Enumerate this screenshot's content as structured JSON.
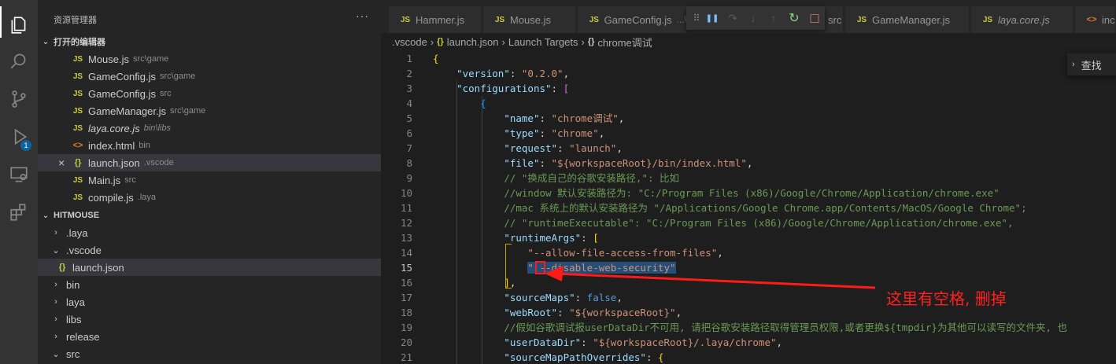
{
  "activity_bar": {
    "items": [
      {
        "icon": "files-icon"
      },
      {
        "icon": "search-icon"
      },
      {
        "icon": "source-control-icon"
      },
      {
        "icon": "debug-icon",
        "badge": "1"
      },
      {
        "icon": "remote-explorer-icon"
      },
      {
        "icon": "extensions-icon"
      }
    ]
  },
  "sidebar": {
    "title": "资源管理器",
    "more": "···",
    "open_editors": {
      "header": "打开的编辑器",
      "items": [
        {
          "name": "Mouse.js",
          "path": "src\\game",
          "type": "js"
        },
        {
          "name": "GameConfig.js",
          "path": "src\\game",
          "type": "js"
        },
        {
          "name": "GameConfig.js",
          "path": "src",
          "type": "js"
        },
        {
          "name": "GameManager.js",
          "path": "src\\game",
          "type": "js"
        },
        {
          "name": "laya.core.js",
          "path": "bin\\libs",
          "type": "js",
          "italic": true
        },
        {
          "name": "index.html",
          "path": "bin",
          "type": "html"
        },
        {
          "name": "launch.json",
          "path": ".vscode",
          "type": "json",
          "active": true
        },
        {
          "name": "Main.js",
          "path": "src",
          "type": "js"
        },
        {
          "name": "compile.js",
          "path": ".laya",
          "type": "js"
        }
      ]
    },
    "project": {
      "header": "HITMOUSE",
      "items": [
        {
          "label": ".laya",
          "kind": "folder",
          "expanded": false,
          "depth": 0
        },
        {
          "label": ".vscode",
          "kind": "folder",
          "expanded": true,
          "depth": 0
        },
        {
          "label": "launch.json",
          "kind": "json",
          "depth": 1,
          "focused": true
        },
        {
          "label": "bin",
          "kind": "folder",
          "expanded": false,
          "depth": 0
        },
        {
          "label": "laya",
          "kind": "folder",
          "expanded": false,
          "depth": 0
        },
        {
          "label": "libs",
          "kind": "folder",
          "expanded": false,
          "depth": 0
        },
        {
          "label": "release",
          "kind": "folder",
          "expanded": false,
          "depth": 0
        },
        {
          "label": "src",
          "kind": "folder",
          "expanded": true,
          "depth": 0
        }
      ]
    }
  },
  "tabs": [
    {
      "label": "Hammer.js",
      "type": "js"
    },
    {
      "label": "Mouse.js",
      "type": "js"
    },
    {
      "label": "GameConfig.js",
      "path": "...\\",
      "type": "js"
    },
    {
      "label": "src",
      "type": "js"
    },
    {
      "label": "GameManager.js",
      "type": "js"
    },
    {
      "label": "laya.core.js",
      "type": "js",
      "italic": true
    },
    {
      "label": "inc",
      "type": "html"
    }
  ],
  "debug_toolbar": {
    "buttons": [
      {
        "name": "drag-handle-icon",
        "glyph": "⠿"
      },
      {
        "name": "pause-icon",
        "glyph": "❚❚"
      },
      {
        "name": "step-over-icon",
        "glyph": "↷"
      },
      {
        "name": "step-into-icon",
        "glyph": "↓"
      },
      {
        "name": "step-out-icon",
        "glyph": "↑"
      },
      {
        "name": "restart-icon",
        "glyph": "↻"
      },
      {
        "name": "stop-icon",
        "glyph": "□"
      }
    ]
  },
  "breadcrumb": [
    ".vscode",
    "launch.json",
    "Launch Targets",
    "chrome调试"
  ],
  "find_widget": {
    "label": "查找"
  },
  "editor": {
    "active_line": 15,
    "lines": [
      {
        "n": "1",
        "text": "{"
      },
      {
        "n": "2",
        "text": "    \"version\": \"0.2.0\","
      },
      {
        "n": "3",
        "text": "    \"configurations\": ["
      },
      {
        "n": "4",
        "text": "        {"
      },
      {
        "n": "5",
        "text": "            \"name\": \"chrome调试\","
      },
      {
        "n": "6",
        "text": "            \"type\": \"chrome\","
      },
      {
        "n": "7",
        "text": "            \"request\": \"launch\","
      },
      {
        "n": "8",
        "text": "            \"file\": \"${workspaceRoot}/bin/index.html\","
      },
      {
        "n": "9",
        "text": "            // \"换成自己的谷歌安装路径,\": 比如"
      },
      {
        "n": "10",
        "text": "            //window 默认安装路径为: \"C:/Program Files (x86)/Google/Chrome/Application/chrome.exe\""
      },
      {
        "n": "11",
        "text": "            //mac 系统上的默认安装路径为 \"/Applications/Google Chrome.app/Contents/MacOS/Google Chrome\";"
      },
      {
        "n": "12",
        "text": "            // \"runtimeExecutable\": \"C:/Program Files (x86)/Google/Chrome/Application/chrome.exe\","
      },
      {
        "n": "13",
        "text": "            \"runtimeArgs\": ["
      },
      {
        "n": "14",
        "text": "                \"--allow-file-access-from-files\","
      },
      {
        "n": "15",
        "text": "                \" --disable-web-security\""
      },
      {
        "n": "16",
        "text": "            ],"
      },
      {
        "n": "17",
        "text": "            \"sourceMaps\": false,"
      },
      {
        "n": "18",
        "text": "            \"webRoot\": \"${workspaceRoot}\","
      },
      {
        "n": "19",
        "text": "            //假如谷歌调试报userDataDir不可用, 请把谷歌安装路径取得管理员权限,或者更换${tmpdir}为其他可以读写的文件夹, 也"
      },
      {
        "n": "20",
        "text": "            \"userDataDir\": \"${workspaceRoot}/.laya/chrome\","
      },
      {
        "n": "21",
        "text": "            \"sourceMapPathOverrides\": {"
      }
    ]
  },
  "annotation": {
    "text": "这里有空格, 删掉",
    "color": "#ff2020"
  }
}
